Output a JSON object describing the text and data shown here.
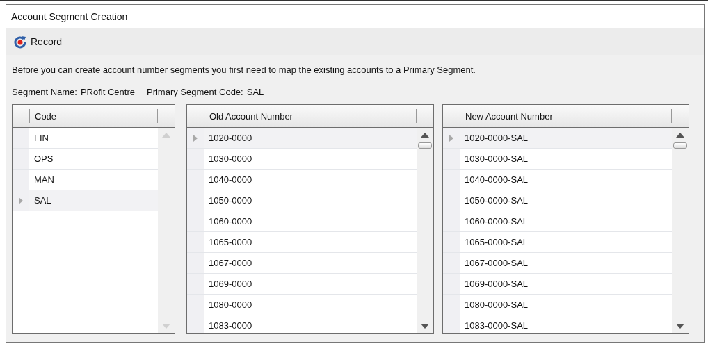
{
  "window": {
    "title": "Account Segment Creation"
  },
  "toolbar": {
    "buttons": [
      {
        "label": "Record"
      }
    ]
  },
  "message": "Before you can create account number segments you first need to map the existing accounts to a Primary Segment.",
  "segment_info": [
    {
      "label": "Segment Name:",
      "value": "PRofit Centre"
    },
    {
      "label": "Primary Segment Code:",
      "value": "SAL"
    }
  ],
  "grids": [
    {
      "header": "Code",
      "scroll_enabled": false,
      "rows": [
        {
          "text": "FIN",
          "selected": false
        },
        {
          "text": "OPS",
          "selected": false
        },
        {
          "text": "MAN",
          "selected": false
        },
        {
          "text": "SAL",
          "selected": true
        }
      ]
    },
    {
      "header": "Old Account Number",
      "scroll_enabled": true,
      "rows": [
        {
          "text": "1020-0000",
          "selected": true
        },
        {
          "text": "1030-0000",
          "selected": false
        },
        {
          "text": "1040-0000",
          "selected": false
        },
        {
          "text": "1050-0000",
          "selected": false
        },
        {
          "text": "1060-0000",
          "selected": false
        },
        {
          "text": "1065-0000",
          "selected": false
        },
        {
          "text": "1067-0000",
          "selected": false
        },
        {
          "text": "1069-0000",
          "selected": false
        },
        {
          "text": "1080-0000",
          "selected": false
        },
        {
          "text": "1083-0000",
          "selected": false
        }
      ]
    },
    {
      "header": "New Account Number",
      "scroll_enabled": true,
      "rows": [
        {
          "text": "1020-0000-SAL",
          "selected": true
        },
        {
          "text": "1030-0000-SAL",
          "selected": false
        },
        {
          "text": "1040-0000-SAL",
          "selected": false
        },
        {
          "text": "1050-0000-SAL",
          "selected": false
        },
        {
          "text": "1060-0000-SAL",
          "selected": false
        },
        {
          "text": "1065-0000-SAL",
          "selected": false
        },
        {
          "text": "1067-0000-SAL",
          "selected": false
        },
        {
          "text": "1069-0000-SAL",
          "selected": false
        },
        {
          "text": "1080-0000-SAL",
          "selected": false
        },
        {
          "text": "1083-0000-SAL",
          "selected": false
        }
      ]
    }
  ]
}
